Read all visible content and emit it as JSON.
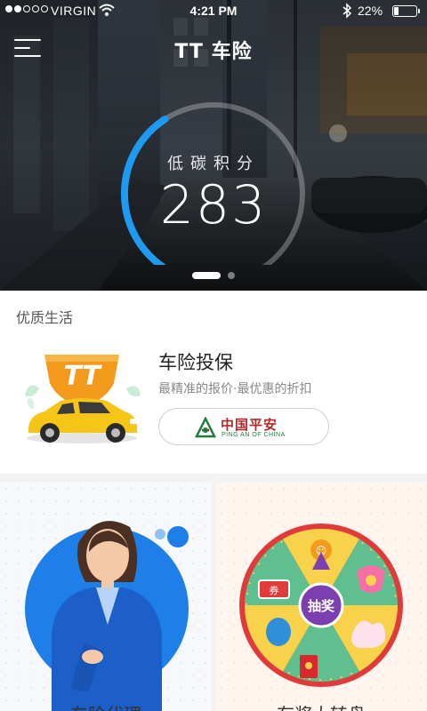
{
  "status_bar": {
    "carrier": "VIRGIN",
    "time": "4:21 PM",
    "battery_percent": "22%",
    "battery_level": 0.22,
    "signal_bars_filled": 2,
    "signal_bars_total": 5
  },
  "nav": {
    "title": "TT 车险",
    "menu_icon": "hamburger-menu-icon"
  },
  "hero": {
    "score_label": "低碳积分",
    "score_value": "283",
    "gauge_fraction": 0.35,
    "carousel_pages": 2,
    "carousel_active": 0
  },
  "quality": {
    "section_title": "优质生活",
    "promo_title": "车险投保",
    "promo_subtitle": "最精准的报价·最优惠的折扣",
    "badge_text": "TT",
    "partner": {
      "name_cn": "中国平安",
      "name_en": "PING AN OF CHINA"
    }
  },
  "cards": [
    {
      "title": "车险代理"
    },
    {
      "title": "有奖大转盘",
      "wheel_center_label": "抽奖",
      "coupon_label": "券"
    }
  ],
  "colors": {
    "gauge_accent": "#1e9bf0",
    "badge_orange": "#f39a1d",
    "taxi_yellow": "#f5c518",
    "pingan_red": "#b8262a",
    "pingan_green": "#1f7a3c",
    "wheel_purple": "#7b3fb0"
  }
}
